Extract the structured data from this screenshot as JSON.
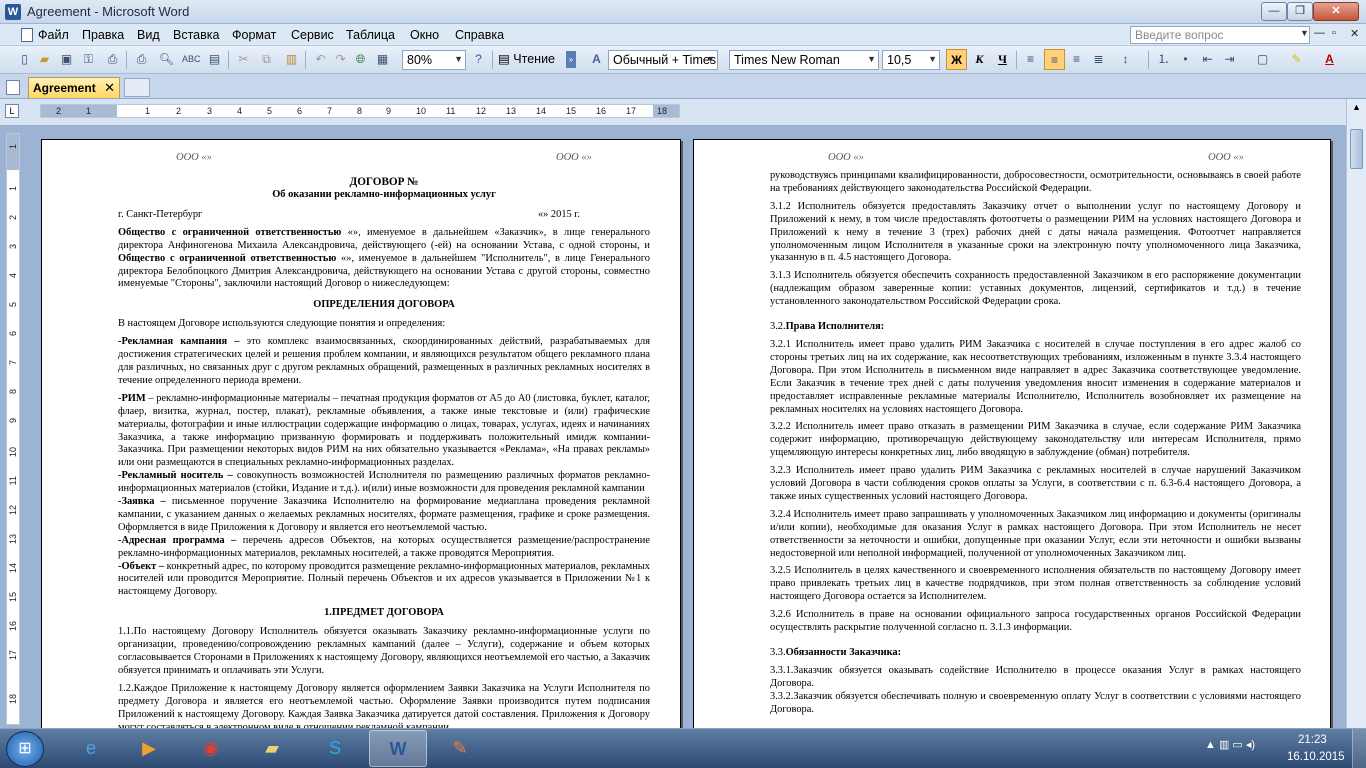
{
  "window": {
    "title": "Agreement - Microsoft Word",
    "min_glyph": "—",
    "max_glyph": "❐",
    "close_glyph": "✕"
  },
  "menu": {
    "items": [
      "Файл",
      "Правка",
      "Вид",
      "Вставка",
      "Формат",
      "Сервис",
      "Таблица",
      "Окно",
      "Справка"
    ],
    "help_placeholder": "Введите вопрос",
    "mdi_min": "—",
    "mdi_restore": "▫",
    "mdi_close": "✕"
  },
  "toolbar": {
    "zoom": "80%",
    "read_label": "Чтение",
    "style": "Обычный + Times",
    "font": "Times New Roman",
    "size": "10,5",
    "bold": "Ж",
    "italic": "К",
    "underline": "Ч"
  },
  "tabs": {
    "active_label": "Agreement",
    "close_glyph": "✕"
  },
  "ruler": {
    "corner": "L",
    "h_numbers": [
      "2",
      "1",
      "1",
      "2",
      "3",
      "4",
      "5",
      "6",
      "7",
      "8",
      "9",
      "10",
      "11",
      "12",
      "13",
      "14",
      "15",
      "16",
      "17",
      "18"
    ],
    "v_numbers": [
      "1",
      "1",
      "2",
      "3",
      "4",
      "5",
      "6",
      "7",
      "8",
      "9",
      "10",
      "11",
      "12",
      "13",
      "14",
      "15",
      "16",
      "17",
      "18"
    ]
  },
  "page1": {
    "header_left": "ООО «»",
    "header_right": "ООО «»",
    "title": "ДОГОВОР №",
    "subtitle": "Об оказании рекламно-информационных услуг",
    "city": "г. Санкт-Петербург",
    "date": "«»  2015 г.",
    "intro_b1": "Общество с ограниченной ответственностью",
    "intro_t1": " «», именуемое в дальнейшем «Заказчик», в лице генерального директора Анфиногенова Михаила Александровича, действующего (-ей) на основании Устава, с одной стороны, и ",
    "intro_b2": "Общество с ограниченной ответственностью",
    "intro_t2": " «», именуемое в дальнейшем \"Исполнитель\", в лице Генерального директора Белобпоцкого Дмитрия Александровича, действующего на основании Устава с другой стороны, совместно именуемые \"Стороны\", заключили настоящий Договор о нижеследующем:",
    "definitions_head": "ОПРЕДЕЛЕНИЯ ДОГОВОРА",
    "definitions_intro": "В настоящем Договоре используются следующие понятия и определения:",
    "def1_term": "-Рекламная кампания –",
    "def1_text": " это комплекс взаимосвязанных, скоординированных действий, разрабатываемых для достижения стратегических целей и решения проблем компании, и являющихся результатом общего рекламного плана для различных, но связанных друг с другом рекламных обращений, размещенных в различных рекламных носителях в течение определенного периода времени.",
    "def2_term": "-РИМ",
    "def2_text": " – рекламно-информационные материалы – печатная продукция форматов от А5 до А0 (листовка, буклет, каталог, флаер, визитка, журнал, постер, плакат), рекламные объявления, а также иные текстовые и (или) графические материалы, фотографии и иные иллюстрации содержащие информацию о лицах, товарах, услугах, идеях и начинаниях Заказчика, а также информацию призванную формировать и поддерживать положительный имидж компании-Заказчика. При размещении некоторых видов РИМ на них обязательно указывается «Реклама», «На правах рекламы» или они размещаются в специальных рекламно-информационных разделах.",
    "def3_term": "-Рекламный носитель –",
    "def3_text": " совокупность возможностей Исполнителя по размещению различных форматов рекламно-информационных материалов (стойки, Издание и т.д.). и(или) иные возможности для проведения рекламной кампании",
    "def4_term": "-Заявка –",
    "def4_text": " письменное поручение Заказчика Исполнителю на формирование медиаплана проведения рекламной кампании, с указанием данных о желаемых рекламных носителях, формате размещения, графике и сроке размещения. Оформляется в виде Приложения к Договору и является его неотъемлемой частью.",
    "def5_term": "-Адресная программа –",
    "def5_text": " перечень адресов Объектов, на которых осуществляется размещение/распространение рекламно-информационных материалов, рекламных носителей, а также проводятся Мероприятия.",
    "def6_term": "-Объект –",
    "def6_text": " конкретный адрес, по которому проводится размещение рекламно-информационных материалов, рекламных носителей или проводится Мероприятие. Полный перечень Объектов и их адресов указывается в Приложении №1 к настоящему Договору.",
    "subject_head": "1.ПРЕДМЕТ ДОГОВОРА",
    "p1_1": "1.1.По настоящему Договору Исполнитель обязуется оказывать Заказчику рекламно-информационные услуги по организации, проведению/сопровождению рекламных кампаний (далее – Услуги), содержание и объем которых согласовывается Сторонами в Приложениях к настоящему Договору, являющихся неотъемлемой его частью, а Заказчик обязуется принимать и оплачивать эти Услуги.",
    "p1_2": "1.2.Каждое Приложение к настоящему Договору является оформлением Заявки Заказчика на Услуги Исполнителя по предмету Договора и является его неотъемлемой частью. Оформление Заявки производится путем подписания Приложений к настоящему Договору. Каждая Заявка Заказчика датируется датой составления. Приложения к Договору могут составляться в электронном виде в отношении рекламной кампании."
  },
  "page2": {
    "header_left": "ООО «»",
    "header_right": "ООО «»",
    "p_cont": "руководствуясь принципами квалифицированности, добросовестности, осмотрительности, основываясь в своей работе на требованиях действующего законодательства Российской Федерации.",
    "p3_1_2": "3.1.2 Исполнитель обязуется предоставлять Заказчику отчет о выполнении услуг по настоящему Договору и Приложений к нему, в том числе предоставлять фотоотчеты о размещении РИМ на условиях настоящего Договора и Приложений к нему в течение 3 (трех) рабочих дней с даты начала размещения. Фотоотчет направляется уполномоченным лицом Исполнителя в указанные сроки на электронную почту уполномоченного лица Заказчика, указанную в п. 4.5 настоящего Договора.",
    "p3_1_3": "3.1.3 Исполнитель обязуется обеспечить сохранность предоставленной Заказчиком в его распоряжение документации (надлежащим образом заверенные копии: уставных документов, лицензий, сертификатов и т.д.) в течение установленного законодательством Российской Федерации срока.",
    "h3_2_num": "3.2.",
    "h3_2": "Права Исполнителя:",
    "p3_2_1": "3.2.1 Исполнитель имеет право удалить РИМ Заказчика с носителей в случае поступления в его адрес жалоб со стороны третьих лиц на их содержание, как несоответствующих требованиям, изложенным в пункте 3.3.4 настоящего Договора. При этом Исполнитель в письменном виде направляет в адрес Заказчика соответствующее уведомление. Если Заказчик в течение трех дней с даты получения уведомления вносит изменения в содержание материалов и предоставляет исправленные рекламные материалы Исполнителю, Исполнитель возобновляет их размещение на рекламных носителях на условиях настоящего Договора.",
    "p3_2_2": "3.2.2 Исполнитель имеет право отказать в размещении РИМ Заказчика в случае, если содержание РИМ Заказчика содержит информацию, противоречащую действующему законодательству или интересам Исполнителя, прямо ущемляющую интересы конкретных лиц, либо вводящую в заблуждение (обман) потребителя.",
    "p3_2_3": "3.2.3 Исполнитель имеет право удалить РИМ Заказчика с рекламных носителей в случае нарушений Заказчиком условий Договора в части соблюдения сроков оплаты за Услуги, в соответствии с п. 6.3-6.4 настоящего Договора, а также иных существенных условий настоящего Договора.",
    "p3_2_4": "3.2.4 Исполнитель имеет право запрашивать у уполномоченных Заказчиком лиц информацию и документы (оригиналы и/или копии), необходимые для оказания Услуг в рамках настоящего Договора. При этом Исполнитель не несет ответственности за неточности и ошибки, допущенные при оказании Услуг, если эти неточности и ошибки вызваны недостоверной или неполной информацией, полученной от уполномоченных Заказчиком лиц.",
    "p3_2_5": "3.2.5 Исполнитель в целях качественного и своевременного исполнения обязательств по настоящему Договору имеет право привлекать третьих лиц в качестве подрядчиков, при этом полная ответственность за соблюдение условий настоящего Договора остается за Исполнителем.",
    "p3_2_6": "3.2.6 Исполнитель в праве на основании официального запроса государственных органов Российской Федерации осуществлять раскрытие полученной согласно п. 3.1.3 информации.",
    "h3_3_num": "3.3.",
    "h3_3": "Обязанности Заказчика:",
    "p3_3_1": "3.3.1.Заказчик обязуется оказывать содействие Исполнителю в процессе оказания Услуг в рамках настоящего Договора.",
    "p3_3_2": "3.3.2.Заказчик обязуется обеспечивать полную и своевременную оплату Услуг в соответствии с условиями настоящего Договора."
  },
  "taskbar": {
    "time": "21:23",
    "date": "16.10.2015"
  }
}
